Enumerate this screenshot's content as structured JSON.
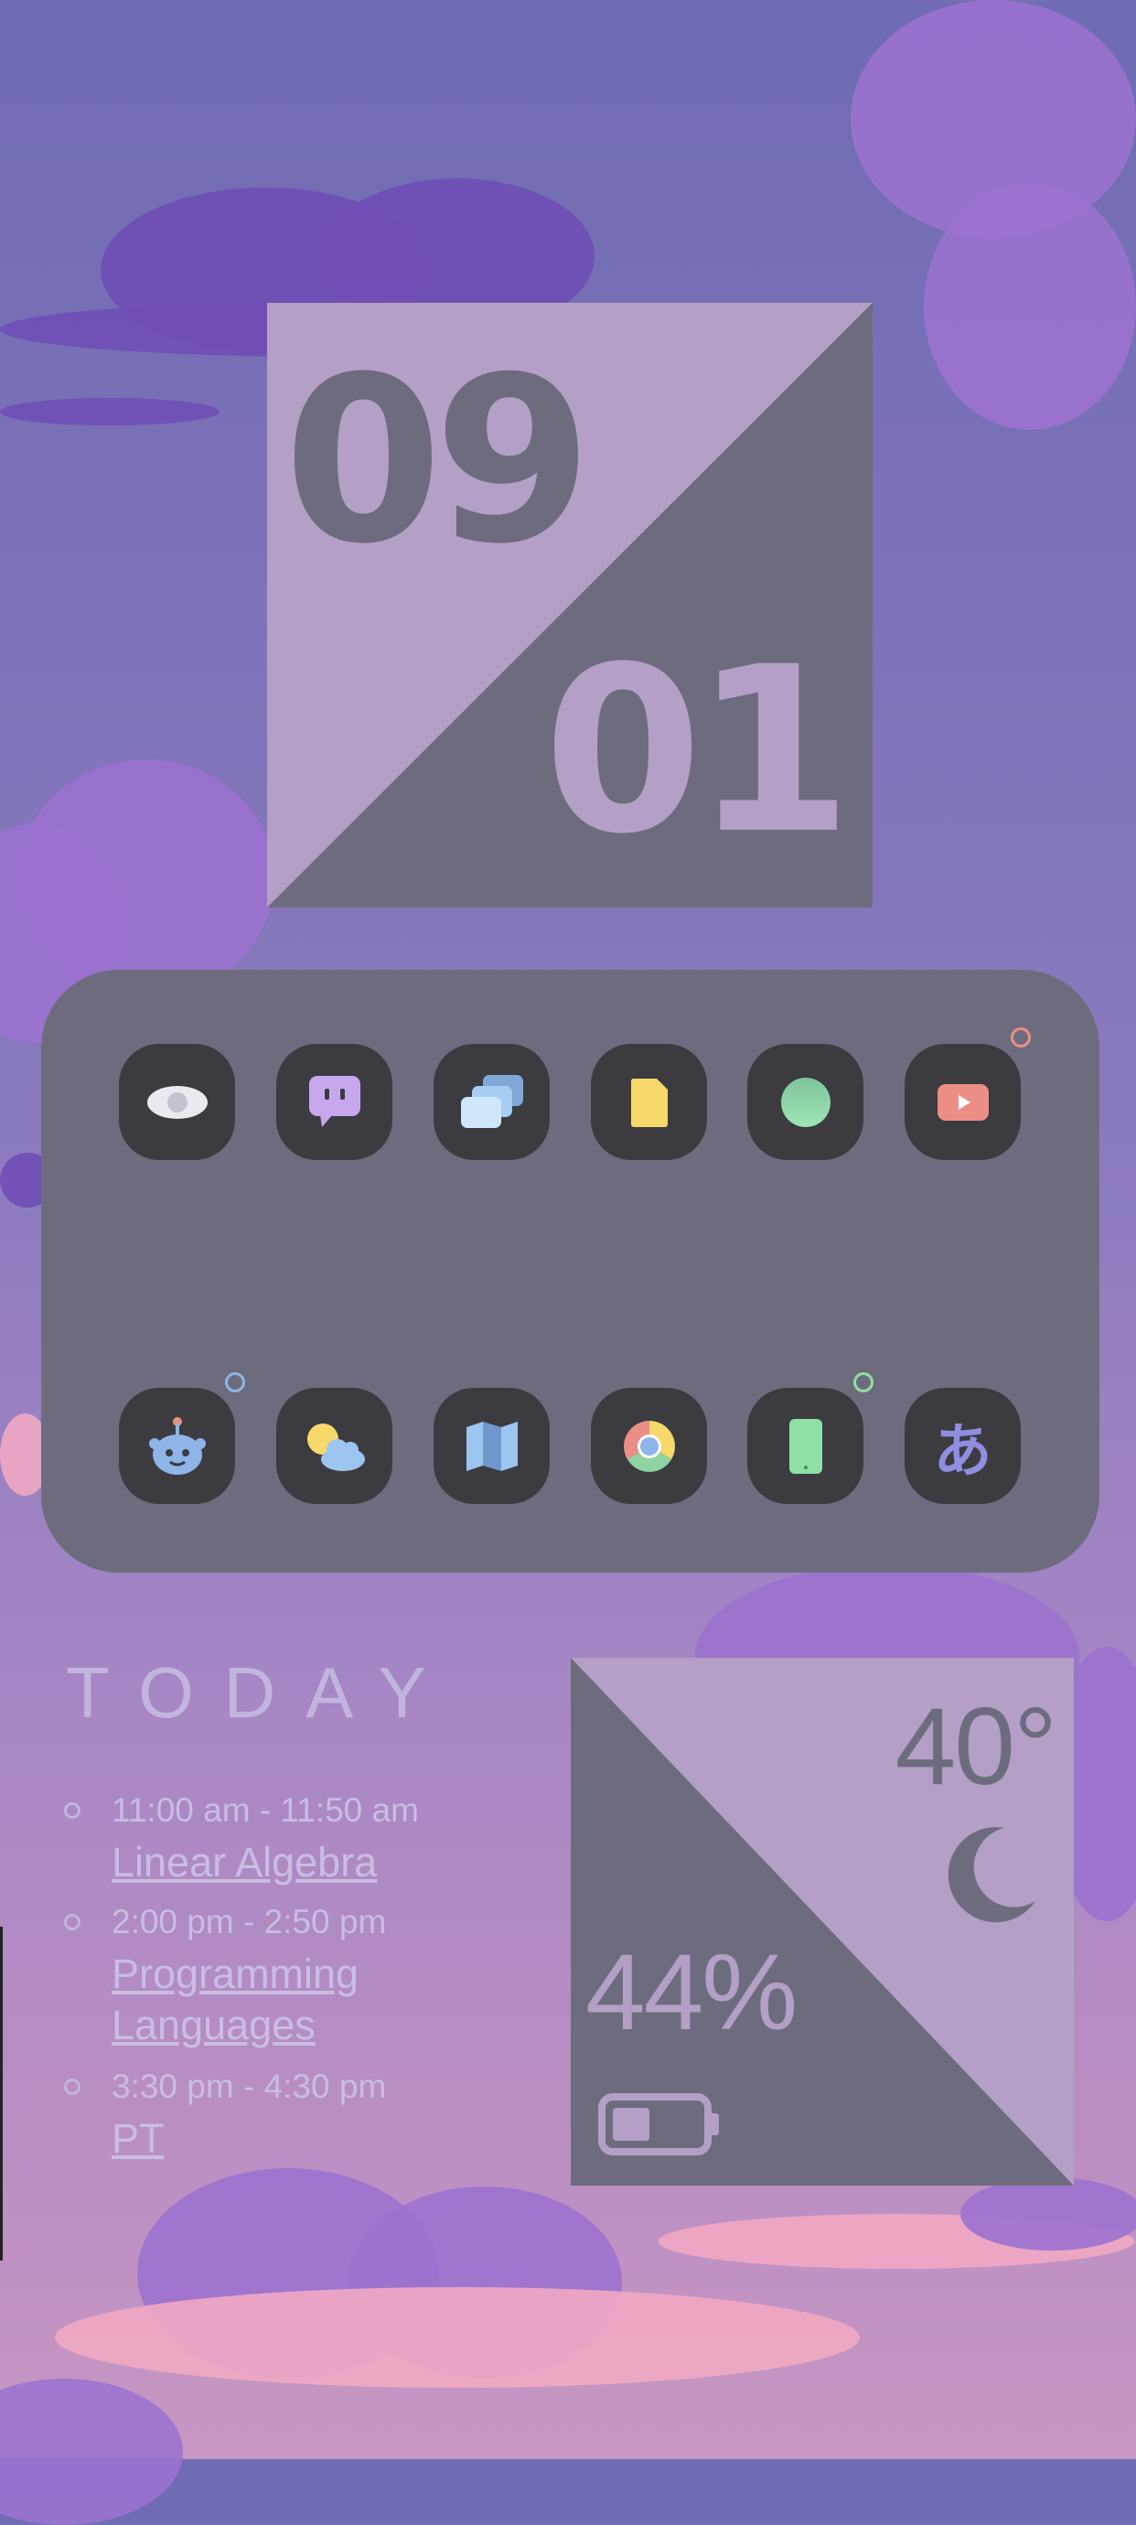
{
  "date": {
    "month": "09",
    "day": "01"
  },
  "apps": {
    "row1": [
      {
        "name": "eye-app",
        "icon": "eye-icon"
      },
      {
        "name": "chat-app",
        "icon": "chat-bubble-icon"
      },
      {
        "name": "cards-app",
        "icon": "stacked-cards-icon"
      },
      {
        "name": "notes-app",
        "icon": "document-icon"
      },
      {
        "name": "circle-app",
        "icon": "green-circle-icon"
      },
      {
        "name": "video-app",
        "icon": "play-icon",
        "notification": true
      }
    ],
    "row2": [
      {
        "name": "robot-app",
        "icon": "robot-icon",
        "notification": true
      },
      {
        "name": "weather-app",
        "icon": "sun-cloud-icon"
      },
      {
        "name": "maps-app",
        "icon": "map-icon"
      },
      {
        "name": "browser-app",
        "icon": "chrome-icon"
      },
      {
        "name": "phone-app",
        "icon": "phone-icon",
        "notification": true
      },
      {
        "name": "language-app",
        "icon": "hiragana-icon",
        "glyph": "あ"
      }
    ]
  },
  "today": {
    "title": "TODAY",
    "events": [
      {
        "time": "11:00 am - 11:50 am",
        "title": "Linear Algebra"
      },
      {
        "time": "2:00 pm - 2:50 pm",
        "title": "Programming Languages"
      },
      {
        "time": "3:30 pm - 4:30 pm",
        "title": "PT"
      }
    ]
  },
  "status": {
    "temperature": "40°",
    "battery": "44%",
    "battery_level": 0.44,
    "weather_icon": "moon-icon"
  },
  "colors": {
    "widget_light": "#b49fc6",
    "widget_dark": "#6d6c7e",
    "dock": "#6d6c7e",
    "app_tile": "#3c3b40",
    "text_light": "#c9bde3"
  }
}
